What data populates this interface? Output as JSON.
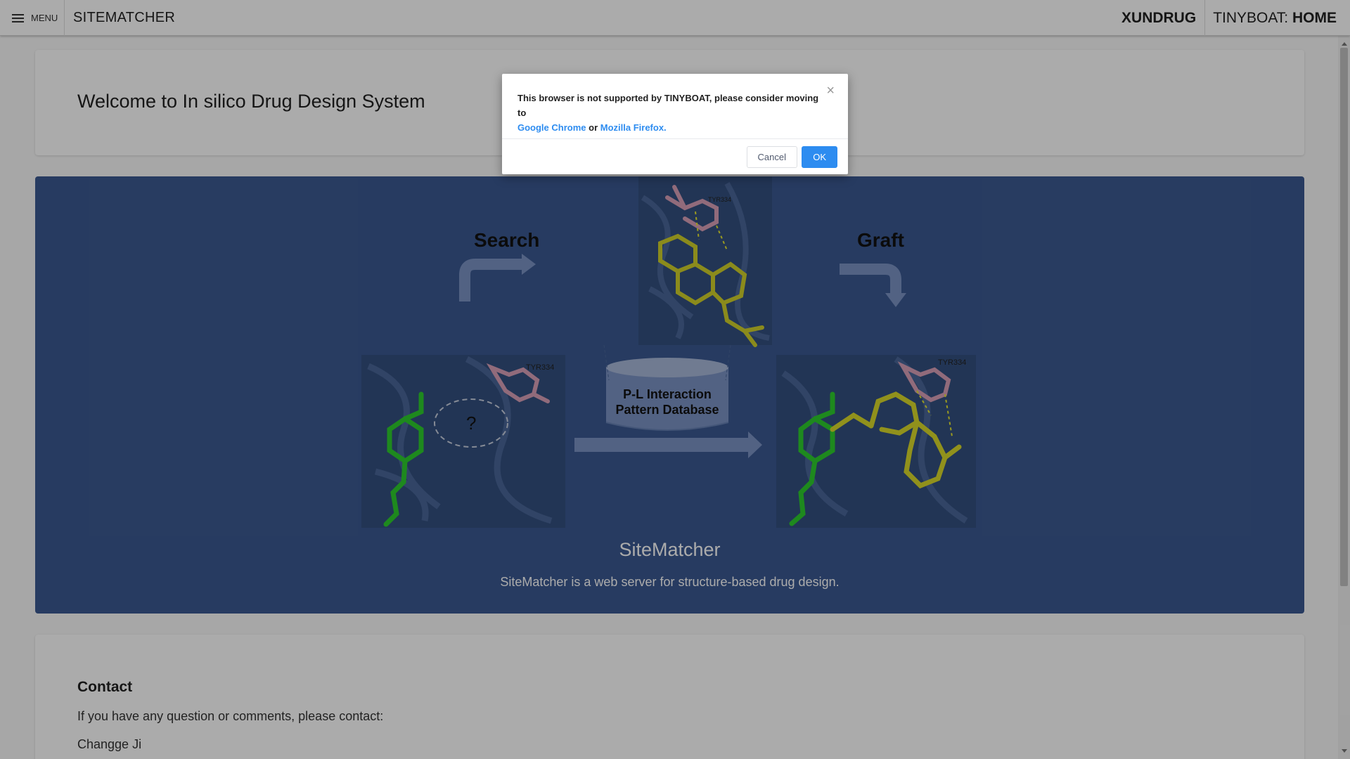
{
  "topbar": {
    "menu_label": "MENU",
    "site_title": "SITEMATCHER",
    "brand": "XUNDRUG",
    "tinyboat_prefix": "TINYBOAT:",
    "tinyboat_page": "HOME"
  },
  "welcome": {
    "title": "Welcome to In silico Drug Design System"
  },
  "hero": {
    "figure": {
      "search_label": "Search",
      "graft_label": "Graft",
      "residue_top": "TYR334",
      "residue_left": "TYR334",
      "residue_right": "TYR334",
      "question_mark": "?",
      "database_line1": "P-L Interaction",
      "database_line2": "Pattern Database"
    },
    "title": "SiteMatcher",
    "description": "SiteMatcher is a web server for structure-based drug design."
  },
  "contact": {
    "title": "Contact",
    "text": "If you have any question or comments, please contact:",
    "name": "Changge Ji"
  },
  "modal": {
    "message": "This browser is not supported by TINYBOAT, please consider moving to",
    "link_chrome": "Google Chrome",
    "or_text": "or",
    "link_firefox": "Mozilla Firefox.",
    "close_icon": "×",
    "cancel_label": "Cancel",
    "ok_label": "OK"
  },
  "colors": {
    "hero_bg": "#3b5991",
    "primary": "#2d8cf0",
    "ligand_yellow": "#d8d82a",
    "ligand_green": "#2ecc2e",
    "residue_pink": "#d8a0b8"
  }
}
